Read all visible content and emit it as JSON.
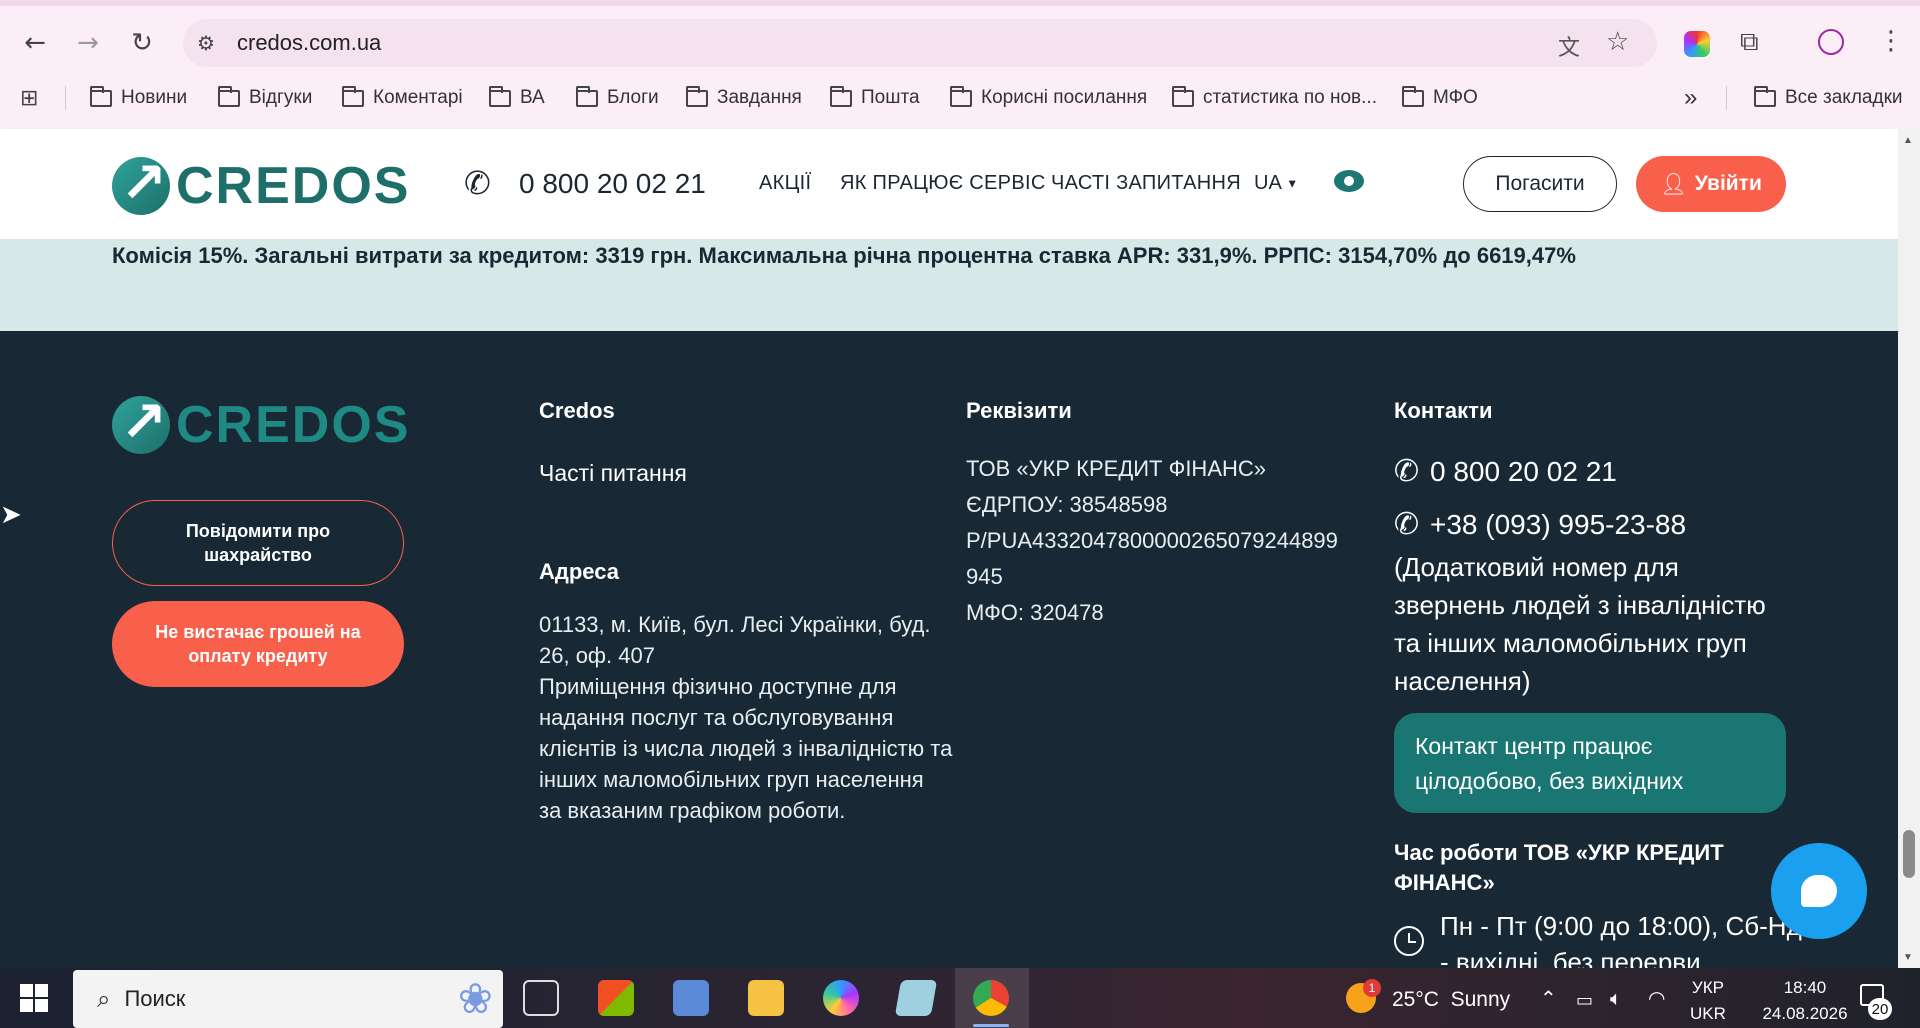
{
  "browser": {
    "url": "credos.com.ua",
    "bookmarks": [
      "Новини",
      "Відгуки",
      "Коментарі",
      "ВА",
      "Блоги",
      "Завдання",
      "Пошта",
      "Корисні посилання",
      "статистика по нов...",
      "МФО"
    ],
    "all_bookmarks": "Все закладки",
    "overflow": "»"
  },
  "header": {
    "logo_text": "CREDOS",
    "phone": "0 800 20 02 21",
    "nav": [
      "АКЦІЇ",
      "ЯК ПРАЦЮЄ СЕРВІС",
      "ЧАСТІ ЗАПИТАННЯ"
    ],
    "lang": "UA",
    "pay_button": "Погасити",
    "login_button": "Увійти"
  },
  "disclaimer": "Комісія 15%. Загальні витрати за кредитом: 3319 грн. Максимальна річна процентна ставка APR: 331,9%. РРПС: 3154,70% до 6619,47%",
  "footer": {
    "logo_text": "CREDOS",
    "fraud_button": "Повідомити про шахрайство",
    "nomoney_button": "Не вистачає грошей на оплату кредиту",
    "col_credos": {
      "title": "Credos",
      "link": "Часті питання"
    },
    "col_address": {
      "title": "Адреса",
      "line1": "01133, м. Київ, бул. Лесі Українки, буд.",
      "line2": "26, оф. 407",
      "access": [
        "Приміщення фізично доступне для",
        "надання послуг та обслуговування",
        "клієнтів із числа людей з інвалідністю та",
        "інших маломобільних груп населення",
        "за вказаним графіком роботи."
      ]
    },
    "col_requisites": {
      "title": "Реквізити",
      "lines": [
        "ТОВ «УКР КРЕДИТ ФІНАНС»",
        "ЄДРПОУ: 38548598",
        "Р/PUA4332047800000265079244899",
        "945",
        "МФО: 320478"
      ]
    },
    "col_contacts": {
      "title": "Контакти",
      "phone1": "0 800 20 02 21",
      "phone2": "+38 (093) 995-23-88",
      "note": [
        "(Додатковий номер для",
        "звернень людей з інвалідністю",
        "та інших маломобільних груп",
        "населення)"
      ],
      "center_line1": "Контакт центр працює",
      "center_line2": "цілодобово, без вихідних",
      "hours_title_1": "Час роботи ТОВ «УКР КРЕДИТ",
      "hours_title_2": "ФІНАНС»",
      "hours_1": "Пн - Пт (9:00 до 18:00), Сб-Нд",
      "hours_2": "- вихідні, без перерви"
    }
  },
  "taskbar": {
    "search_placeholder": "Поиск",
    "weather": "25°C  Sunny",
    "weather_badge": "1",
    "lang_top": "УКР",
    "lang_bottom": "UKR",
    "time": "18:40",
    "date": "24.08.2026",
    "notif_count": "20"
  },
  "colors": {
    "accent": "#f9604b",
    "brand": "#1e6f6a",
    "footer_bg": "#182834",
    "disclaimer_bg": "#d6e8e8"
  }
}
